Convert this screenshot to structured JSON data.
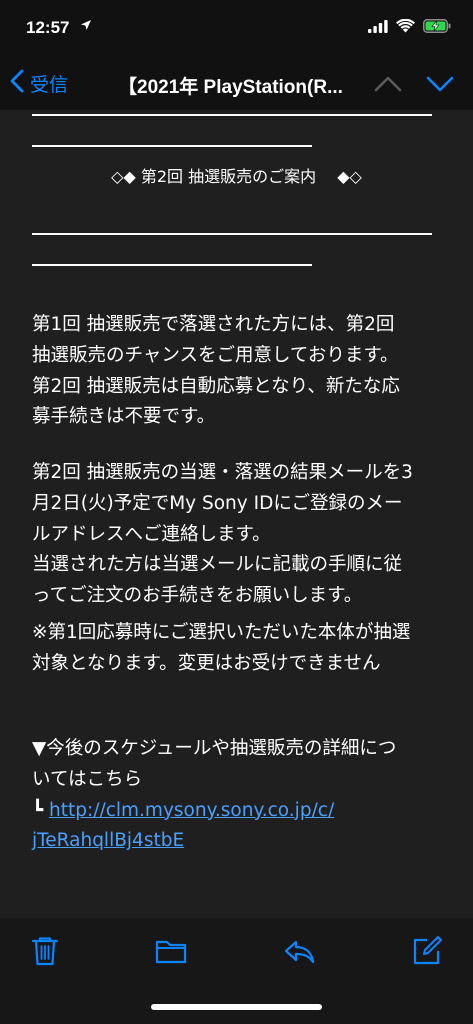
{
  "status_bar": {
    "time": "12:57",
    "location_icon": "location-arrow-icon",
    "signal_icon": "cellular-signal-icon",
    "wifi_icon": "wifi-icon",
    "battery_icon": "battery-charging-icon"
  },
  "nav": {
    "back_label": "受信",
    "title": "【2021年 PlayStation(R...",
    "accent_color": "#0a84ff"
  },
  "email": {
    "heading": "◇◆  第2回 抽選販売のご案内  　◆◇",
    "para1": [
      "第1回 抽選販売で落選された方には、第2回",
      "抽選販売のチャンスをご用意しております。",
      "第2回 抽選販売は自動応募となり、新たな応",
      "募手続きは不要です。"
    ],
    "para2": [
      "第2回 抽選販売の当選・落選の結果メールを3",
      "月2日(火)予定でMy Sony IDにご登録のメー",
      "ルアドレスへご連絡します。",
      "当選された方は当選メールに記載の手順に従",
      "ってご注文のお手続きをお願いします。"
    ],
    "para3": [
      "※第1回応募時にご選択いただいた本体が抽選",
      "対象となります。変更はお受けできません"
    ],
    "para4": [
      "▼今後のスケジュールや抽選販売の詳細につ",
      "いてはこちら"
    ],
    "link_prefix": " ┗ ",
    "link_line1": "http://clm.mysony.sony.co.jp/c/",
    "link_line2": "jTeRahqllBj4stbE"
  },
  "toolbar": {
    "trash_icon": "trash-icon",
    "folder_icon": "folder-icon",
    "reply_icon": "reply-icon",
    "compose_icon": "compose-icon"
  }
}
